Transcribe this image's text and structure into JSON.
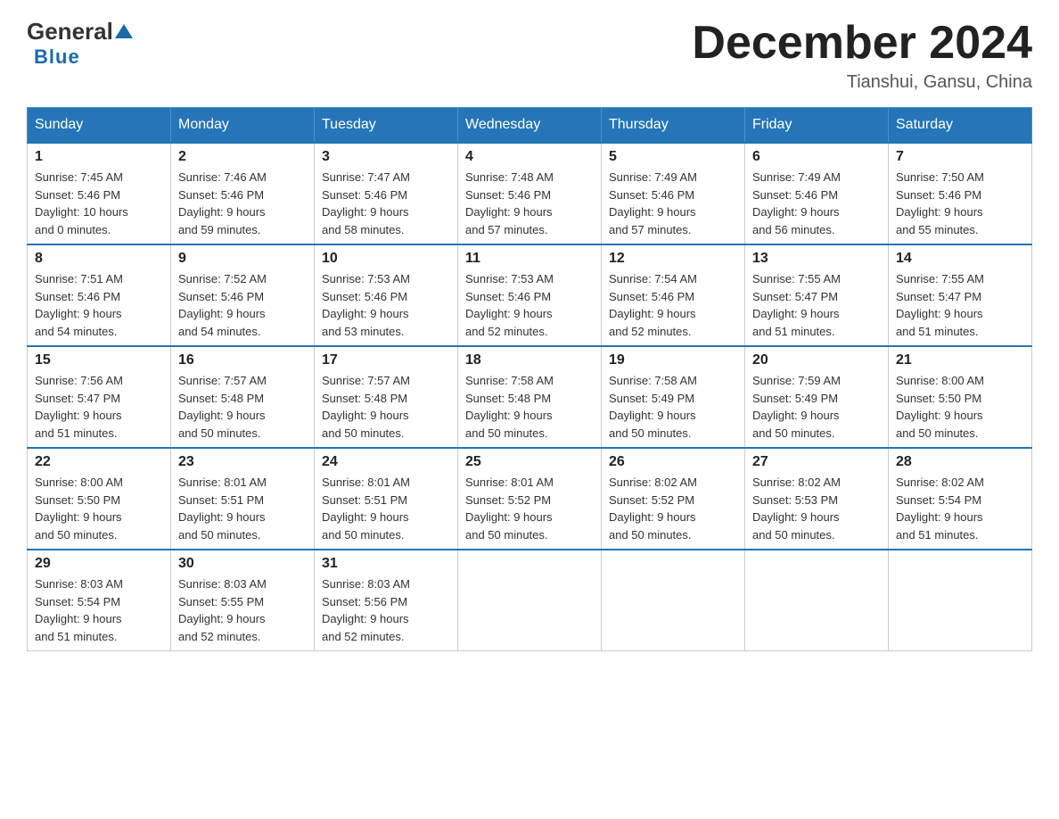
{
  "header": {
    "logo": {
      "general": "General",
      "blue": "Blue",
      "tagline": "Blue"
    },
    "title": "December 2024",
    "subtitle": "Tianshui, Gansu, China"
  },
  "days_of_week": [
    "Sunday",
    "Monday",
    "Tuesday",
    "Wednesday",
    "Thursday",
    "Friday",
    "Saturday"
  ],
  "weeks": [
    [
      {
        "day": "1",
        "sunrise": "7:45 AM",
        "sunset": "5:46 PM",
        "daylight": "10 hours and 0 minutes."
      },
      {
        "day": "2",
        "sunrise": "7:46 AM",
        "sunset": "5:46 PM",
        "daylight": "9 hours and 59 minutes."
      },
      {
        "day": "3",
        "sunrise": "7:47 AM",
        "sunset": "5:46 PM",
        "daylight": "9 hours and 58 minutes."
      },
      {
        "day": "4",
        "sunrise": "7:48 AM",
        "sunset": "5:46 PM",
        "daylight": "9 hours and 57 minutes."
      },
      {
        "day": "5",
        "sunrise": "7:49 AM",
        "sunset": "5:46 PM",
        "daylight": "9 hours and 57 minutes."
      },
      {
        "day": "6",
        "sunrise": "7:49 AM",
        "sunset": "5:46 PM",
        "daylight": "9 hours and 56 minutes."
      },
      {
        "day": "7",
        "sunrise": "7:50 AM",
        "sunset": "5:46 PM",
        "daylight": "9 hours and 55 minutes."
      }
    ],
    [
      {
        "day": "8",
        "sunrise": "7:51 AM",
        "sunset": "5:46 PM",
        "daylight": "9 hours and 54 minutes."
      },
      {
        "day": "9",
        "sunrise": "7:52 AM",
        "sunset": "5:46 PM",
        "daylight": "9 hours and 54 minutes."
      },
      {
        "day": "10",
        "sunrise": "7:53 AM",
        "sunset": "5:46 PM",
        "daylight": "9 hours and 53 minutes."
      },
      {
        "day": "11",
        "sunrise": "7:53 AM",
        "sunset": "5:46 PM",
        "daylight": "9 hours and 52 minutes."
      },
      {
        "day": "12",
        "sunrise": "7:54 AM",
        "sunset": "5:46 PM",
        "daylight": "9 hours and 52 minutes."
      },
      {
        "day": "13",
        "sunrise": "7:55 AM",
        "sunset": "5:47 PM",
        "daylight": "9 hours and 51 minutes."
      },
      {
        "day": "14",
        "sunrise": "7:55 AM",
        "sunset": "5:47 PM",
        "daylight": "9 hours and 51 minutes."
      }
    ],
    [
      {
        "day": "15",
        "sunrise": "7:56 AM",
        "sunset": "5:47 PM",
        "daylight": "9 hours and 51 minutes."
      },
      {
        "day": "16",
        "sunrise": "7:57 AM",
        "sunset": "5:48 PM",
        "daylight": "9 hours and 50 minutes."
      },
      {
        "day": "17",
        "sunrise": "7:57 AM",
        "sunset": "5:48 PM",
        "daylight": "9 hours and 50 minutes."
      },
      {
        "day": "18",
        "sunrise": "7:58 AM",
        "sunset": "5:48 PM",
        "daylight": "9 hours and 50 minutes."
      },
      {
        "day": "19",
        "sunrise": "7:58 AM",
        "sunset": "5:49 PM",
        "daylight": "9 hours and 50 minutes."
      },
      {
        "day": "20",
        "sunrise": "7:59 AM",
        "sunset": "5:49 PM",
        "daylight": "9 hours and 50 minutes."
      },
      {
        "day": "21",
        "sunrise": "8:00 AM",
        "sunset": "5:50 PM",
        "daylight": "9 hours and 50 minutes."
      }
    ],
    [
      {
        "day": "22",
        "sunrise": "8:00 AM",
        "sunset": "5:50 PM",
        "daylight": "9 hours and 50 minutes."
      },
      {
        "day": "23",
        "sunrise": "8:01 AM",
        "sunset": "5:51 PM",
        "daylight": "9 hours and 50 minutes."
      },
      {
        "day": "24",
        "sunrise": "8:01 AM",
        "sunset": "5:51 PM",
        "daylight": "9 hours and 50 minutes."
      },
      {
        "day": "25",
        "sunrise": "8:01 AM",
        "sunset": "5:52 PM",
        "daylight": "9 hours and 50 minutes."
      },
      {
        "day": "26",
        "sunrise": "8:02 AM",
        "sunset": "5:52 PM",
        "daylight": "9 hours and 50 minutes."
      },
      {
        "day": "27",
        "sunrise": "8:02 AM",
        "sunset": "5:53 PM",
        "daylight": "9 hours and 50 minutes."
      },
      {
        "day": "28",
        "sunrise": "8:02 AM",
        "sunset": "5:54 PM",
        "daylight": "9 hours and 51 minutes."
      }
    ],
    [
      {
        "day": "29",
        "sunrise": "8:03 AM",
        "sunset": "5:54 PM",
        "daylight": "9 hours and 51 minutes."
      },
      {
        "day": "30",
        "sunrise": "8:03 AM",
        "sunset": "5:55 PM",
        "daylight": "9 hours and 52 minutes."
      },
      {
        "day": "31",
        "sunrise": "8:03 AM",
        "sunset": "5:56 PM",
        "daylight": "9 hours and 52 minutes."
      },
      null,
      null,
      null,
      null
    ]
  ],
  "labels": {
    "sunrise": "Sunrise:",
    "sunset": "Sunset:",
    "daylight": "Daylight:"
  }
}
